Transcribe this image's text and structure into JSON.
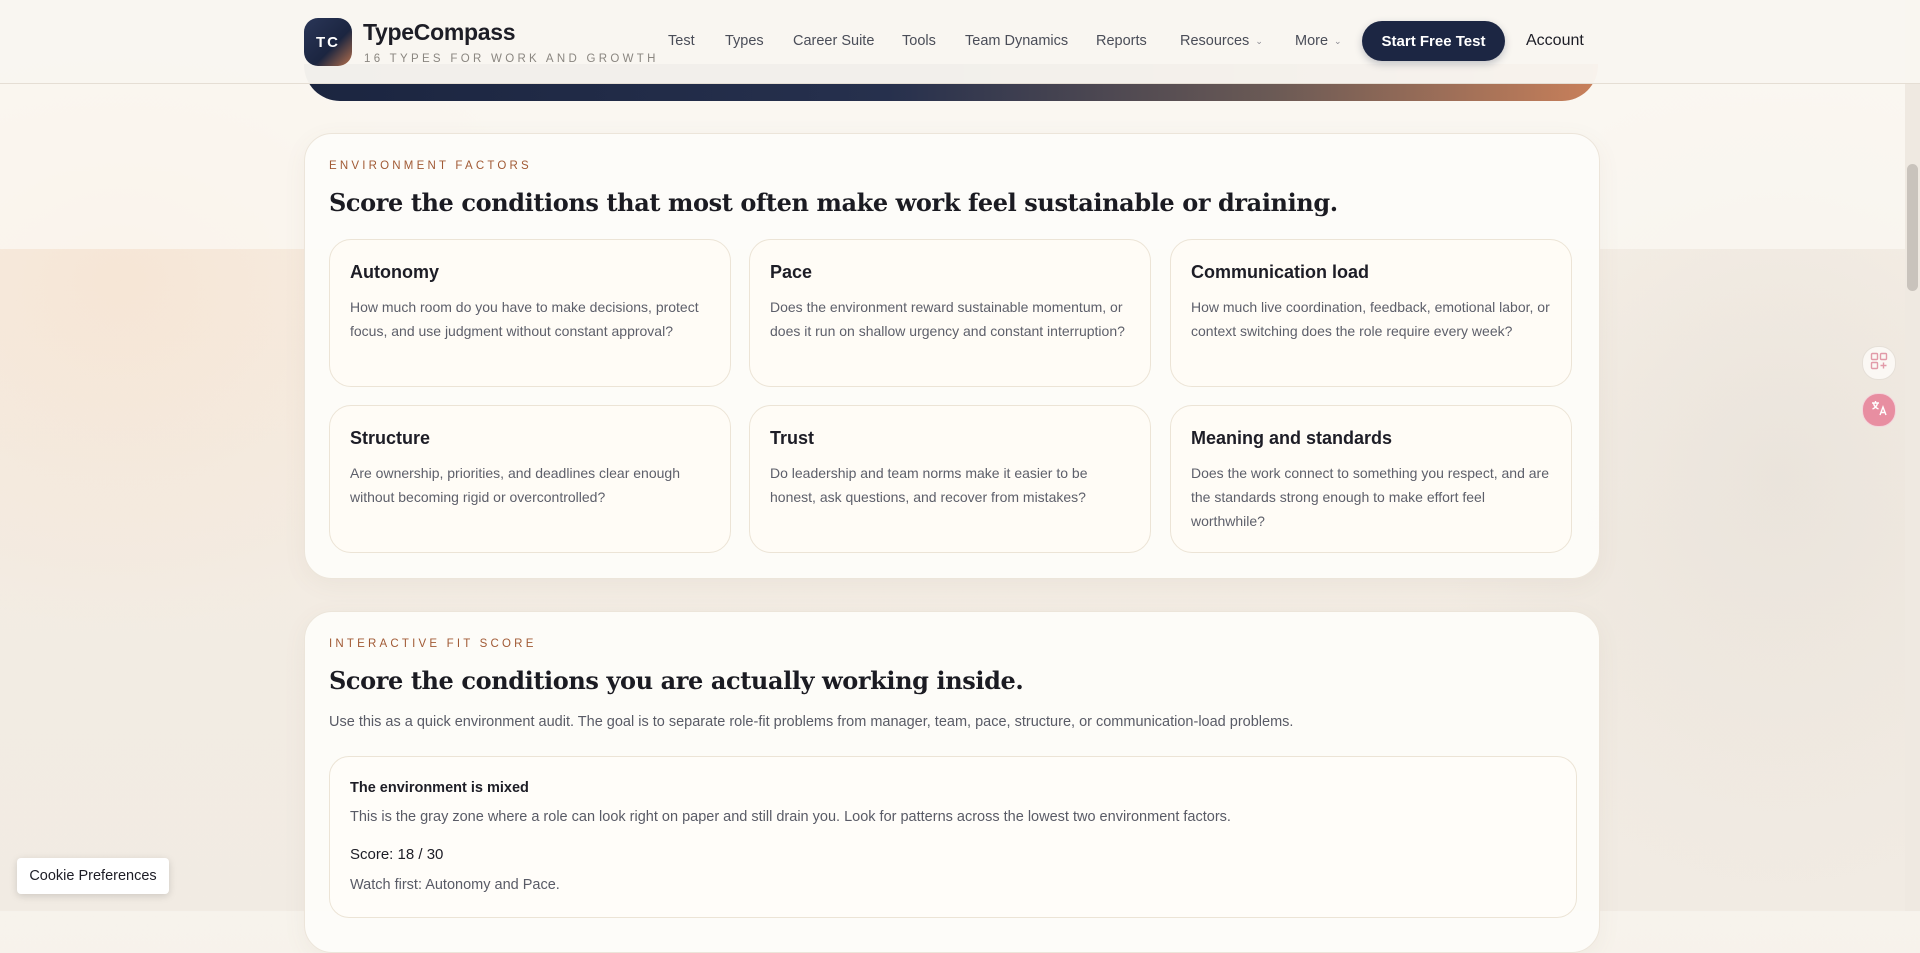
{
  "header": {
    "logo_initials": "TC",
    "brand_name": "TypeCompass",
    "brand_tagline": "16 TYPES FOR WORK AND GROWTH",
    "nav": [
      {
        "label": "Test"
      },
      {
        "label": "Types"
      },
      {
        "label": "Career Suite"
      },
      {
        "label": "Tools"
      },
      {
        "label": "Team Dynamics"
      },
      {
        "label": "Reports"
      },
      {
        "label": "Resources"
      },
      {
        "label": "More"
      }
    ],
    "dropdown_chevron": "⌄",
    "cta_label": "Start Free Test",
    "account_label": "Account"
  },
  "environment": {
    "eyebrow": "ENVIRONMENT FACTORS",
    "title": "Score the conditions that most often make work feel sustainable or draining.",
    "cards": [
      {
        "title": "Autonomy",
        "desc": "How much room do you have to make decisions, protect focus, and use judgment without constant approval?"
      },
      {
        "title": "Pace",
        "desc": "Does the environment reward sustainable momentum, or does it run on shallow urgency and constant interruption?"
      },
      {
        "title": "Communication load",
        "desc": "How much live coordination, feedback, emotional labor, or context switching does the role require every week?"
      },
      {
        "title": "Structure",
        "desc": "Are ownership, priorities, and deadlines clear enough without becoming rigid or overcontrolled?"
      },
      {
        "title": "Trust",
        "desc": "Do leadership and team norms make it easier to be honest, ask questions, and recover from mistakes?"
      },
      {
        "title": "Meaning and standards",
        "desc": "Does the work connect to something you respect, and are the standards strong enough to make effort feel worthwhile?"
      }
    ]
  },
  "fit_score": {
    "eyebrow": "INTERACTIVE FIT SCORE",
    "title": "Score the conditions you are actually working inside.",
    "intro": "Use this as a quick environment audit. The goal is to separate role-fit problems from manager, team, pace, structure, or communication-load problems.",
    "result_heading": "The environment is mixed",
    "result_text": "This is the gray zone where a role can look right on paper and still drain you. Look for patterns across the lowest two environment factors.",
    "score_label": "Score: 18 / 30",
    "watch_label": "Watch first: Autonomy and Pace."
  },
  "cookie_label": "Cookie Preferences",
  "side_widgets": [
    {
      "icon": "apps-grid-icon"
    },
    {
      "icon": "translate-icon"
    }
  ],
  "colors": {
    "navy": "#1c2643",
    "accent_orange": "#c9805a",
    "eyebrow": "#a15a35"
  }
}
